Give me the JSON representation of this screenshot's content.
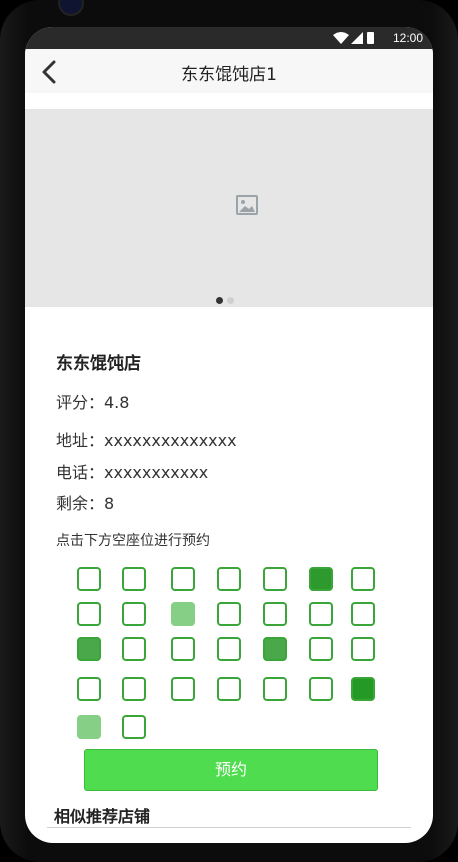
{
  "status_bar": {
    "time": "12:00"
  },
  "app_bar": {
    "title": "东东馄饨店1"
  },
  "banner": {
    "dot_count": 2,
    "active_index": 0
  },
  "shop": {
    "name": "东东馄饨店",
    "rating": "评分：4.8",
    "address": "地址：xxxxxxxxxxxxxx",
    "phone": "电话：xxxxxxxxxxx",
    "remaining": "剩余：8"
  },
  "booking": {
    "hint": "点击下方空座位进行预约",
    "seat_rows": [
      [
        "empty",
        "empty",
        "empty",
        "empty",
        "empty",
        "taken-dark",
        "empty"
      ],
      [
        "empty",
        "empty",
        "taken-light",
        "empty",
        "empty",
        "empty",
        "empty"
      ],
      [
        "taken-med",
        "empty",
        "empty",
        "empty",
        "taken-med",
        "empty",
        "empty"
      ],
      [
        "empty",
        "empty",
        "empty",
        "empty",
        "empty",
        "empty",
        "taken-darker"
      ],
      [
        "taken-light",
        "empty"
      ]
    ],
    "button_label": "预约"
  },
  "similar_section": {
    "title": "相似推荐店铺"
  },
  "colors": {
    "accent": "#4fdc4f",
    "seat_border": "#3aa63a",
    "app_bar_bg": "#f7f7f7"
  }
}
